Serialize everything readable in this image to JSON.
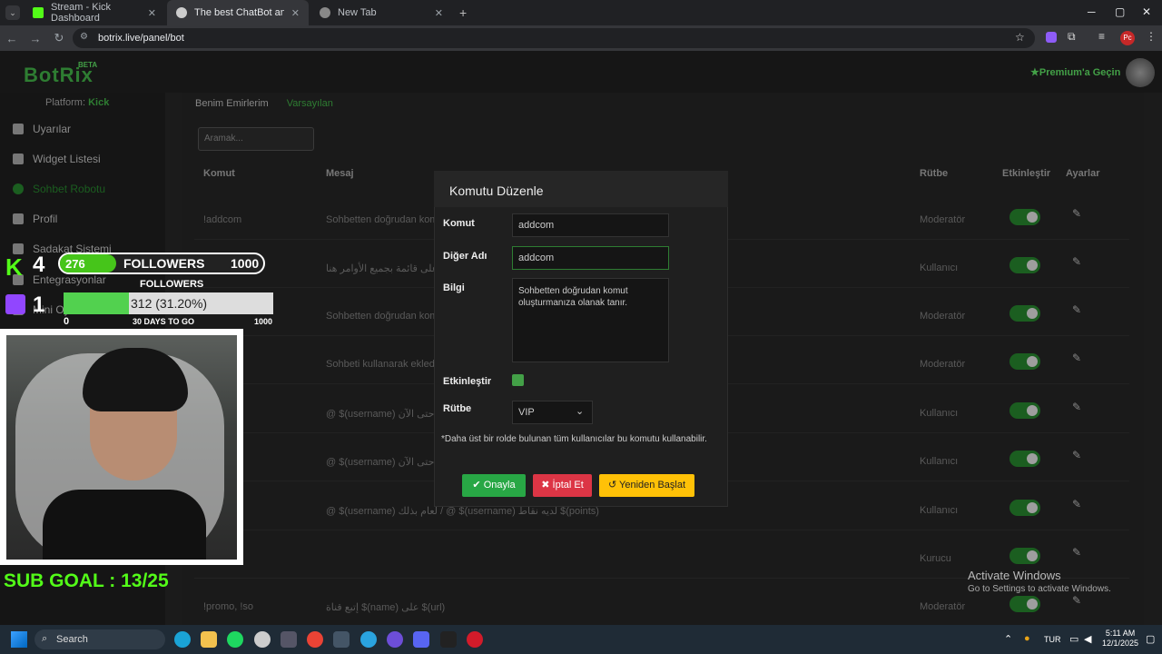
{
  "browser": {
    "tabs": [
      {
        "title": "Stream - Kick Dashboard",
        "active": false
      },
      {
        "title": "The best ChatBot and Widgets",
        "active": true
      },
      {
        "title": "New Tab",
        "active": false
      }
    ],
    "url": "botrix.live/panel/bot",
    "profile_initials": "Pc"
  },
  "app": {
    "logo": "BotRix",
    "beta": "BETA",
    "premium": "Premium'a Geçin",
    "platform_label": "Platform:",
    "platform_value": "Kick"
  },
  "sidebar": {
    "items": [
      {
        "label": "Uyarılar"
      },
      {
        "label": "Widget Listesi"
      },
      {
        "label": "Sohbet Robotu"
      },
      {
        "label": "Profil"
      },
      {
        "label": "Sadakat Sistemi"
      },
      {
        "label": "Entegrasyonlar"
      },
      {
        "label": "Mini Oyunlar"
      }
    ]
  },
  "main": {
    "tabs": [
      "Benim Emirlerim",
      "Varsayılan"
    ],
    "search_placeholder": "Aramak...",
    "columns": [
      "Komut",
      "Mesaj",
      "Rütbe",
      "Etkinleştir",
      "Ayarlar"
    ],
    "rows": [
      {
        "command": "!addcom",
        "message": "Sohbetten doğrudan kom",
        "rank": "Moderatör"
      },
      {
        "command": "!comm",
        "message": "على قائمة بجميع الأوامر هنا",
        "rank": "Kullanıcı"
      },
      {
        "command": "",
        "message": "Sohbetten doğrudan kom",
        "rank": "Moderatör"
      },
      {
        "command": "",
        "message": "Sohbeti kullanarak ekledi",
        "rank": "Moderatör"
      },
      {
        "command": "",
        "message": "@ $(username) حتى الآن / @ $(username) القناة ل",
        "rank": "Kullanıcı"
      },
      {
        "command": "",
        "message": "@ $(username) حتى الآن / @ $(username) المستوى",
        "rank": "Kullanıcı"
      },
      {
        "command": "",
        "message": "@ $(username) لعام بذلك / @ $(username) لديه نقاط $(points)",
        "rank": "Kullanıcı"
      },
      {
        "command": "",
        "message": "",
        "rank": "Kurucu"
      },
      {
        "command": "!promo, !so",
        "message": "إتبع قناة $(name) على $(url)",
        "rank": "Moderatör"
      }
    ]
  },
  "modal": {
    "title": "Komutu Düzenle",
    "command_label": "Komut",
    "command_value": "addcom",
    "alias_label": "Diğer Adı",
    "alias_value": "addcom",
    "info_label": "Bilgi",
    "info_value": "Sohbetten doğrudan komut oluşturmanıza olanak tanır.",
    "enable_label": "Etkinleştir",
    "rank_label": "Rütbe",
    "rank_value": "VIP",
    "note": "*Daha üst bir rolde bulunan tüm kullanıcılar bu komutu kullanabilir.",
    "confirm": "Onayla",
    "cancel": "İptal Et",
    "reset": "Yeniden Başlat"
  },
  "overlay": {
    "kick_count": "4",
    "followers_current": "276",
    "followers_label": "FOLLOWERS",
    "followers_goal": "1000",
    "followers_progress": 0.276,
    "twitch_count": "1",
    "followers_label2": "FOLLOWERS",
    "goal_text": "312 (31.20%)",
    "goal_progress": 0.312,
    "goal_min": "0",
    "goal_days": "30 DAYS TO GO",
    "goal_max": "1000",
    "sub_goal": "SUB GOAL : 13/25"
  },
  "windows": {
    "activate_title": "Activate Windows",
    "activate_sub": "Go to Settings to activate Windows.",
    "search": "Search",
    "lang": "TUR",
    "time": "5:11 AM",
    "date": "12/1/2025"
  }
}
